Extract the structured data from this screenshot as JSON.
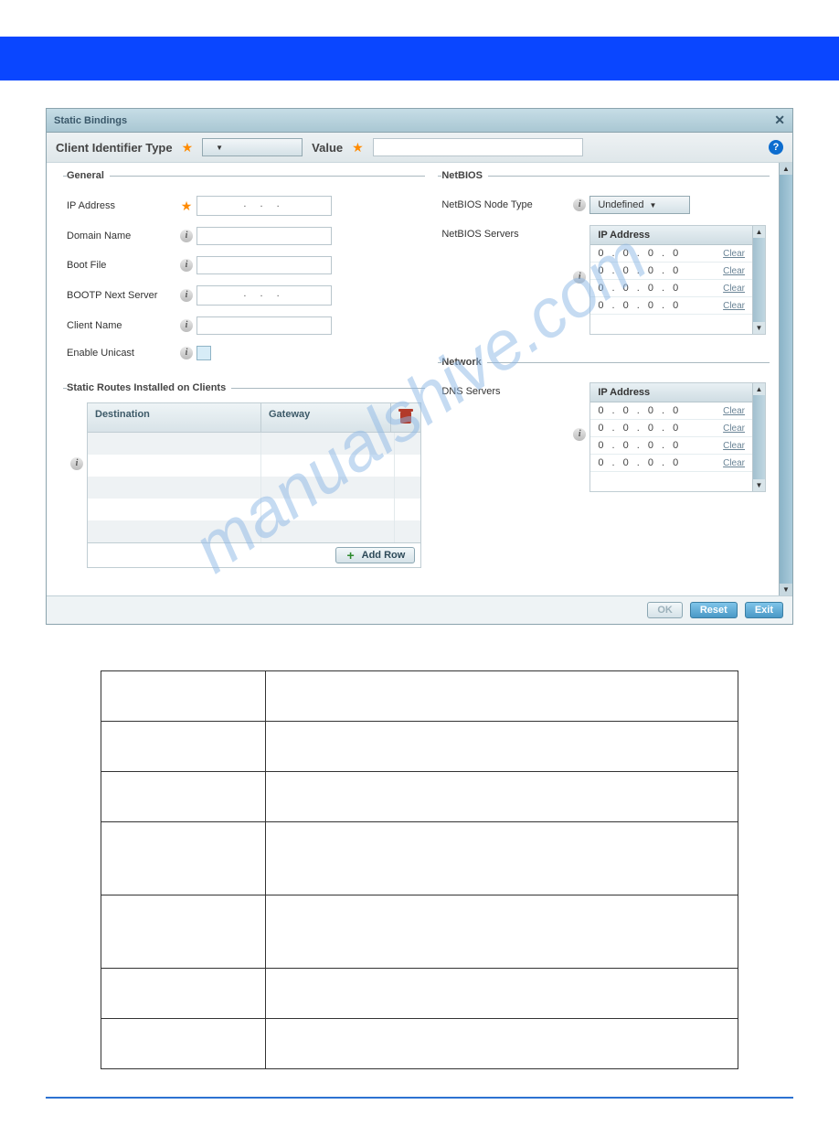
{
  "watermark": "manualshive.com",
  "dialog": {
    "title": "Static Bindings",
    "headrow": {
      "clientIdTypeLabel": "Client Identifier Type",
      "valueLabel": "Value"
    },
    "general": {
      "legend": "General",
      "ipAddressLabel": "IP Address",
      "ipAddressValue": ".   .   .",
      "domainNameLabel": "Domain Name",
      "domainNameValue": "",
      "bootFileLabel": "Boot File",
      "bootFileValue": "",
      "bootpNextLabel": "BOOTP Next Server",
      "bootpNextValue": ".   .   .",
      "clientNameLabel": "Client Name",
      "clientNameValue": "",
      "enableUnicastLabel": "Enable Unicast"
    },
    "staticRoutes": {
      "legend": "Static Routes Installed on Clients",
      "headers": {
        "destination": "Destination",
        "gateway": "Gateway"
      },
      "addRowLabel": "Add Row"
    },
    "netbios": {
      "legend": "NetBIOS",
      "nodeTypeLabel": "NetBIOS Node Type",
      "nodeTypeValue": "Undefined",
      "serversLabel": "NetBIOS Servers",
      "ipHeader": "IP Address",
      "rows": [
        {
          "ip": "0 . 0 . 0 . 0",
          "clear": "Clear"
        },
        {
          "ip": "0 . 0 . 0 . 0",
          "clear": "Clear"
        },
        {
          "ip": "0 . 0 . 0 . 0",
          "clear": "Clear"
        },
        {
          "ip": "0 . 0 . 0 . 0",
          "clear": "Clear"
        }
      ]
    },
    "network": {
      "legend": "Network",
      "dnsLabel": "DNS Servers",
      "ipHeader": "IP Address",
      "rows": [
        {
          "ip": "0 . 0 . 0 . 0",
          "clear": "Clear"
        },
        {
          "ip": "0 . 0 . 0 . 0",
          "clear": "Clear"
        },
        {
          "ip": "0 . 0 . 0 . 0",
          "clear": "Clear"
        },
        {
          "ip": "0 . 0 . 0 . 0",
          "clear": "Clear"
        }
      ]
    },
    "buttons": {
      "ok": "OK",
      "reset": "Reset",
      "exit": "Exit"
    }
  }
}
